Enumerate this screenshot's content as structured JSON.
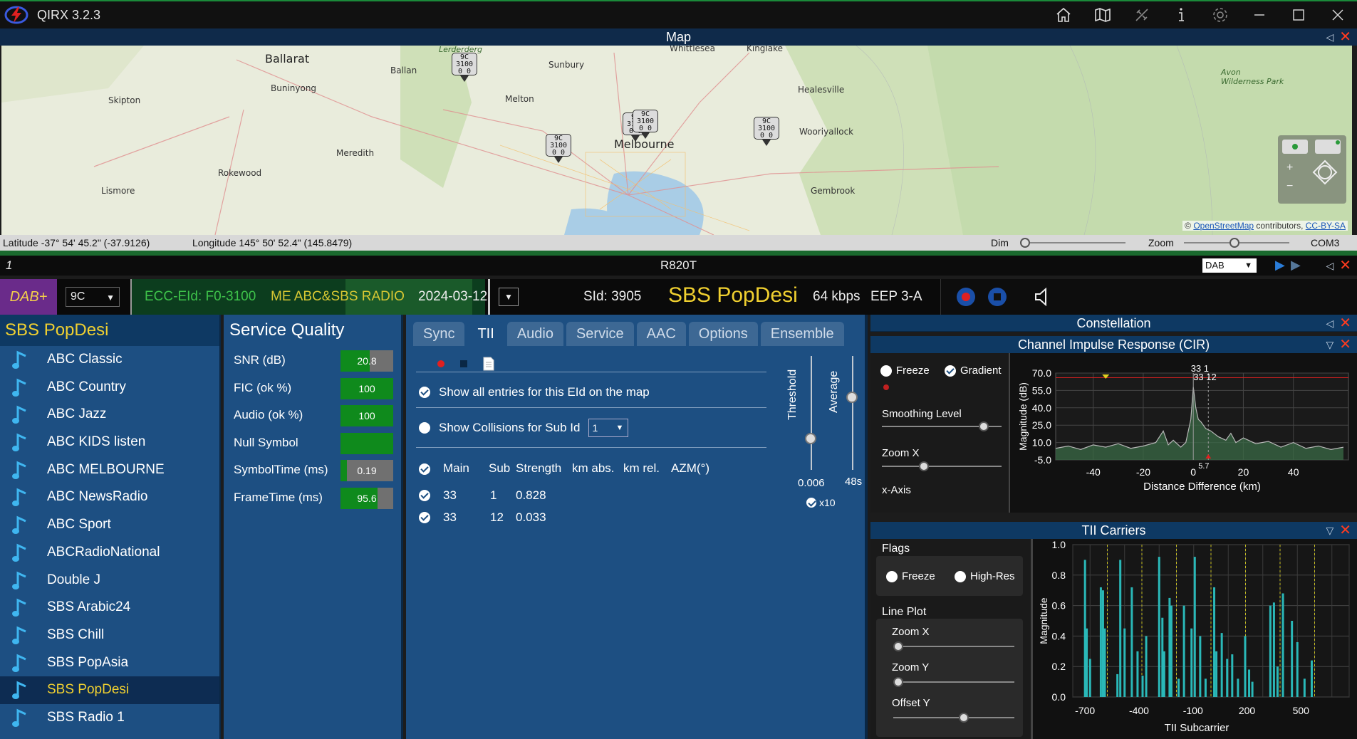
{
  "window": {
    "title": "QIRX 3.2.3",
    "toolbar_icons": [
      "home-icon",
      "map-icon",
      "satellite-icon",
      "info-icon",
      "gear-icon"
    ]
  },
  "map": {
    "header": "Map",
    "places": [
      "Whittlesea",
      "Kinglake",
      "Ballarat",
      "Ballan",
      "Sunbury",
      "Buninyong",
      "Skipton",
      "Melton",
      "Healesville",
      "Melbourne",
      "Wooriyallock",
      "Meredith",
      "Rokewood",
      "Lismore",
      "Gembrook",
      "Lerderderg",
      "Avon Wilderness Park"
    ],
    "markers": [
      {
        "lines": [
          "9C",
          "3100",
          "0 0"
        ]
      },
      {
        "lines": [
          "9C",
          "3100",
          "0 0"
        ]
      },
      {
        "lines": [
          "9C",
          "3100",
          "0 0"
        ]
      },
      {
        "lines": [
          "9C",
          "3100",
          "0 0"
        ]
      },
      {
        "lines": [
          "9C",
          "3100",
          "0 0"
        ]
      }
    ],
    "attribution": {
      "prefix": "© ",
      "link": "OpenStreetMap",
      "suffix": " contributors, ",
      "license": "CC-BY-SA"
    },
    "latitude": "Latitude -37° 54' 45.2\" (-37.9126)",
    "longitude": "Longitude 145° 50' 52.4\" (145.8479)",
    "dim_label": "Dim",
    "zoom_label": "Zoom",
    "port": "COM3"
  },
  "receiver": {
    "index": "1",
    "name": "R820T",
    "mode": "DAB"
  },
  "info": {
    "format": "DAB+",
    "channel": "9C",
    "ecc_eid": "ECC-EId: F0-3100",
    "ensemble": "ME ABC&SBS RADIO",
    "date": "2024-03-12",
    "sid": "SId: 3905",
    "service": "SBS PopDesi",
    "bitrate": "64 kbps",
    "eep": "EEP 3-A"
  },
  "services": {
    "title": "SBS PopDesi",
    "items": [
      "ABC Classic",
      "ABC Country",
      "ABC Jazz",
      "ABC KIDS listen",
      "ABC MELBOURNE",
      "ABC NewsRadio",
      "ABC Sport",
      "ABCRadioNational",
      "Double J",
      "SBS Arabic24",
      "SBS Chill",
      "SBS PopAsia",
      "SBS PopDesi",
      "SBS Radio 1"
    ],
    "selected": "SBS PopDesi"
  },
  "quality": {
    "title": "Service Quality",
    "rows": [
      {
        "label": "SNR (dB)",
        "value": "20.8",
        "fraction": 0.55
      },
      {
        "label": "FIC (ok %)",
        "value": "100",
        "fraction": 1.0
      },
      {
        "label": "Audio (ok %)",
        "value": "100",
        "fraction": 1.0
      },
      {
        "label": "Null Symbol",
        "value": "",
        "fraction": 1.0
      },
      {
        "label": "SymbolTime (ms)",
        "value": "0.19",
        "fraction": 0.12
      },
      {
        "label": "FrameTime (ms)",
        "value": "95.6",
        "fraction": 0.7
      }
    ]
  },
  "tabs": {
    "items": [
      "Sync",
      "TII",
      "Audio",
      "Service",
      "AAC",
      "Options",
      "Ensemble"
    ],
    "active": "TII"
  },
  "tii": {
    "show_all": "Show all entries for this EId on the map",
    "show_collisions": "Show Collisions for Sub Id",
    "sub_id": "1",
    "columns": [
      "Main",
      "Sub",
      "Strength",
      "km abs.",
      "km rel.",
      "AZM(°)"
    ],
    "rows": [
      {
        "main": "33",
        "sub": "1",
        "strength": "0.828"
      },
      {
        "main": "33",
        "sub": "12",
        "strength": "0.033"
      }
    ],
    "threshold_label": "Threshold",
    "threshold_value": "0.006",
    "average_label": "Average",
    "average_value": "48s",
    "x10_label": "x10"
  },
  "constellation": {
    "header": "Constellation"
  },
  "cir": {
    "header": "Channel Impulse Response (CIR)",
    "freeze": "Freeze",
    "gradient": "Gradient",
    "smoothing": "Smoothing Level",
    "zoom_x": "Zoom X",
    "x_axis": "x-Axis",
    "peak_label": "33 1",
    "peak_label2": "33 12",
    "bottom_marker": "5.7",
    "chart_data": {
      "type": "area",
      "xlabel": "Distance Difference (km)",
      "ylabel": "Magnitude (dB)",
      "xlim": [
        -55,
        62
      ],
      "ylim": [
        -5,
        70
      ],
      "yticks": [
        "70.0",
        "55.0",
        "40.0",
        "25.0",
        "10.0",
        "-5.0"
      ],
      "xticks": [
        "-40",
        "-20",
        "0",
        "20",
        "40"
      ],
      "x": [
        -55,
        -50,
        -45,
        -40,
        -35,
        -30,
        -25,
        -20,
        -15,
        -12,
        -10,
        -8,
        -5,
        -3,
        -1,
        0,
        1,
        2,
        3,
        5,
        7,
        10,
        13,
        15,
        17,
        20,
        25,
        30,
        35,
        40,
        45,
        50,
        55,
        60
      ],
      "y": [
        5,
        7,
        4,
        8,
        6,
        9,
        5,
        7,
        10,
        20,
        8,
        12,
        6,
        10,
        30,
        58,
        40,
        30,
        28,
        22,
        20,
        15,
        12,
        18,
        10,
        14,
        9,
        11,
        6,
        10,
        5,
        7,
        4,
        6
      ]
    }
  },
  "tii_carriers": {
    "header": "TII Carriers",
    "flags": "Flags",
    "freeze": "Freeze",
    "high_res": "High-Res",
    "line_plot": "Line Plot",
    "zoom_x": "Zoom X",
    "zoom_y": "Zoom Y",
    "offset_y": "Offset Y",
    "chart_data": {
      "type": "bar",
      "xlabel": "TII Subcarrier",
      "ylabel": "Magnitude",
      "xlim": [
        -768,
        768
      ],
      "ylim": [
        0,
        1.0
      ],
      "yticks": [
        "1.0",
        "0.8",
        "0.6",
        "0.4",
        "0.2",
        "0.0"
      ],
      "xticks": [
        "-700",
        "-400",
        "-100",
        "200",
        "500"
      ],
      "x": [
        -700,
        -690,
        -672,
        -612,
        -600,
        -590,
        -520,
        -504,
        -480,
        -440,
        -408,
        -380,
        -360,
        -288,
        -270,
        -260,
        -230,
        -220,
        -180,
        -150,
        -108,
        -90,
        -60,
        -30,
        18,
        30,
        60,
        90,
        118,
        150,
        190,
        212,
        230,
        330,
        350,
        370,
        400,
        450,
        480,
        520,
        560
      ],
      "values": [
        0.9,
        0.45,
        0.25,
        0.72,
        0.7,
        0.45,
        0.15,
        0.9,
        0.45,
        0.72,
        0.3,
        0.14,
        0.4,
        0.92,
        0.52,
        0.3,
        0.65,
        0.6,
        0.12,
        0.6,
        0.45,
        0.92,
        0.4,
        0.12,
        0.72,
        0.3,
        0.42,
        0.25,
        0.28,
        0.12,
        0.4,
        0.18,
        0.1,
        0.6,
        0.62,
        0.2,
        0.68,
        0.5,
        0.36,
        0.12,
        0.24
      ]
    }
  }
}
